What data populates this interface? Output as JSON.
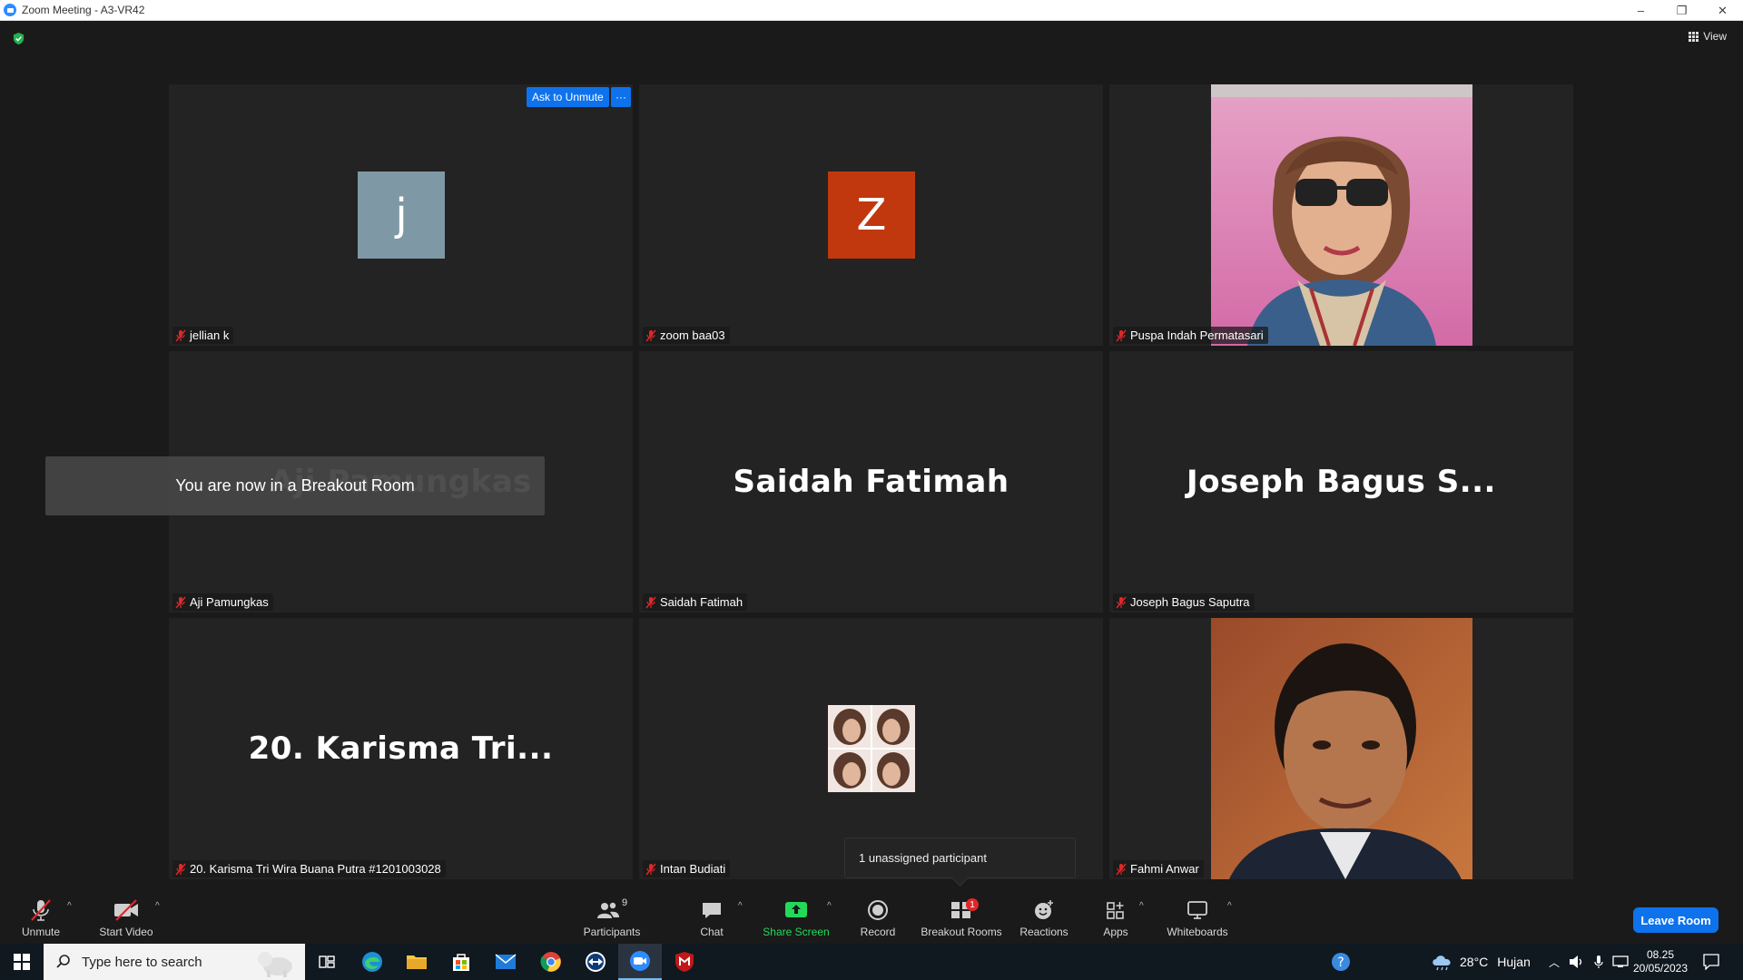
{
  "window": {
    "title": "Zoom Meeting - A3-VR42",
    "minimize": "–",
    "restore": "❐",
    "close": "✕",
    "view_label": "View"
  },
  "tiles": [
    {
      "name": "jellian k",
      "avatar_letter": "j",
      "avatar_color": "#7f98a5"
    },
    {
      "name": "zoom baa03",
      "avatar_letter": "Z",
      "avatar_color": "#c1380e"
    },
    {
      "name": "Puspa Indah Permatasari"
    },
    {
      "name": "Aji Pamungkas",
      "display": "Aji Pamungkas"
    },
    {
      "name": "Saidah Fatimah",
      "display": "Saidah Fatimah"
    },
    {
      "name": "Joseph Bagus Saputra",
      "display": "Joseph Bagus S..."
    },
    {
      "name": "20. Karisma Tri Wira Buana Putra #1201003028",
      "display": "20. Karisma Tri..."
    },
    {
      "name": "Intan Budiati"
    },
    {
      "name": "Fahmi Anwar"
    }
  ],
  "overlays": {
    "ask_to_unmute": "Ask to Unmute",
    "more": "···",
    "breakout_toast": "You are now in a Breakout Room",
    "unassigned": "1 unassigned participant"
  },
  "toolbar": {
    "unmute": "Unmute",
    "start_video": "Start Video",
    "participants": "Participants",
    "participants_count": "9",
    "chat": "Chat",
    "share_screen": "Share Screen",
    "record": "Record",
    "breakout_rooms": "Breakout Rooms",
    "breakout_badge": "1",
    "reactions": "Reactions",
    "apps": "Apps",
    "whiteboards": "Whiteboards",
    "leave_room": "Leave Room",
    "caret": "^"
  },
  "taskbar": {
    "search_placeholder": "Type here to search",
    "weather_temp": "28°C",
    "weather_text": "Hujan",
    "time": "08.25",
    "date": "20/05/2023"
  },
  "colors": {
    "accent_blue": "#0e72ed",
    "share_green": "#23d959",
    "muted_red": "#e02828",
    "badge_red": "#e02828"
  }
}
